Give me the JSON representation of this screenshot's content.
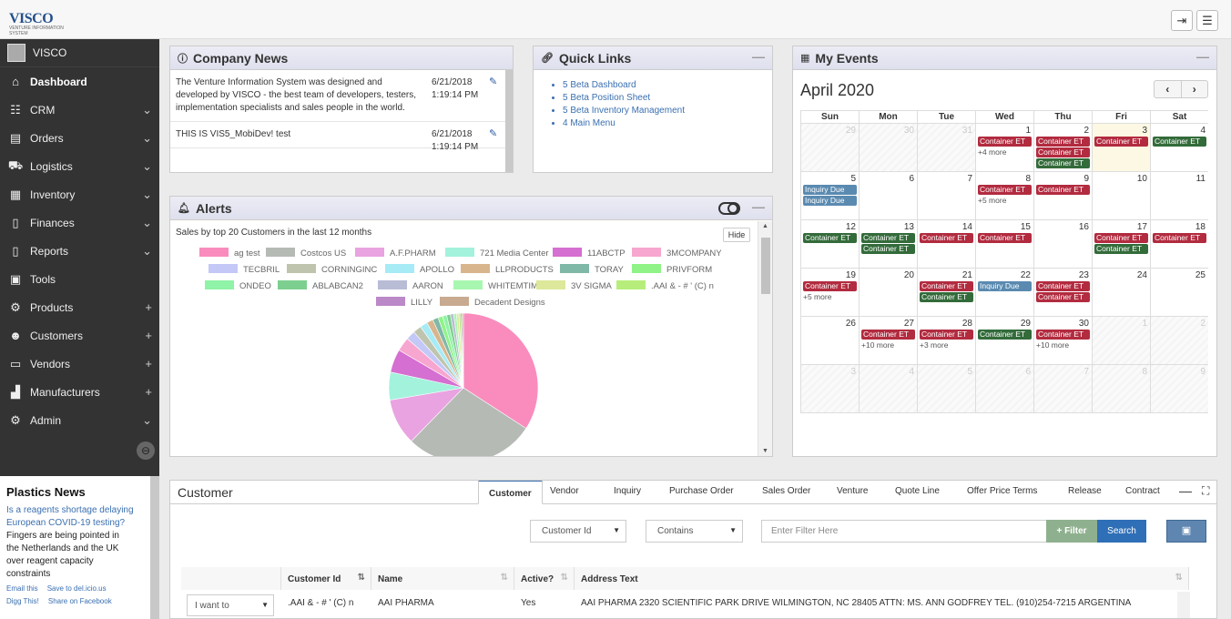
{
  "app": {
    "logo_text": "VISCO",
    "logo_sub": "VENTURE INFORMATION SYSTEM"
  },
  "topbar": {
    "logout_icon": "logout-icon",
    "menu_icon": "hamburger-icon"
  },
  "sidebar": {
    "user": "VISCO",
    "items": [
      {
        "label": "Dashboard",
        "icon": "home-icon",
        "glyph": "⌂",
        "ex": ""
      },
      {
        "label": "CRM",
        "icon": "handshake-icon",
        "glyph": "☷",
        "ex": "⌄"
      },
      {
        "label": "Orders",
        "icon": "orders-icon",
        "glyph": "▤",
        "ex": "⌄"
      },
      {
        "label": "Logistics",
        "icon": "truck-icon",
        "glyph": "⛟",
        "ex": "⌄"
      },
      {
        "label": "Inventory",
        "icon": "warehouse-icon",
        "glyph": "▦",
        "ex": "⌄"
      },
      {
        "label": "Finances",
        "icon": "document-icon",
        "glyph": "▯",
        "ex": "⌄"
      },
      {
        "label": "Reports",
        "icon": "report-icon",
        "glyph": "▯",
        "ex": "⌄"
      },
      {
        "label": "Tools",
        "icon": "briefcase-icon",
        "glyph": "▣",
        "ex": ""
      },
      {
        "label": "Products",
        "icon": "gear-icon",
        "glyph": "⚙",
        "ex": "+"
      },
      {
        "label": "Customers",
        "icon": "users-icon",
        "glyph": "☻",
        "ex": "+"
      },
      {
        "label": "Vendors",
        "icon": "vendor-icon",
        "glyph": "▭",
        "ex": "+"
      },
      {
        "label": "Manufacturers",
        "icon": "factory-icon",
        "glyph": "▟",
        "ex": "+"
      },
      {
        "label": "Admin",
        "icon": "cog-icon",
        "glyph": "⚙",
        "ex": "⌄"
      }
    ]
  },
  "plastics": {
    "title": "Plastics News",
    "headline": "Is a reagents shortage delaying European COVID-19 testing?",
    "body": "Fingers are being pointed in the Netherlands and the UK over reagent capacity constraints",
    "share": [
      "Email this",
      "Save to del.icio.us",
      "Digg This!",
      "Share on Facebook"
    ]
  },
  "company_news": {
    "title": "Company News",
    "rows": [
      {
        "text": "The Venture Information System was designed and developed by VISCO - the best team of developers, testers, implementation specialists and sales people in the world.",
        "date": "6/21/2018 1:19:14 PM"
      },
      {
        "text": "THIS IS VIS5_MobiDev! test",
        "date": "6/21/2018 1:19:14 PM"
      }
    ]
  },
  "quick_links": {
    "title": "Quick Links",
    "links": [
      "5 Beta Dashboard",
      "5 Beta Position Sheet",
      "5 Beta Inventory Management",
      "4 Main Menu"
    ]
  },
  "alerts": {
    "title": "Alerts",
    "subtitle": "Sales by top 20 Customers in the last 12 months",
    "hide": "Hide"
  },
  "chart_data": {
    "type": "pie",
    "title": "Sales by top 20 Customers in the last 12 months",
    "categories": [
      "ag test",
      "Costcos US",
      "A.F.PHARM",
      "721 Media Center",
      "11ABCTP",
      "3MCOMPANY",
      "TECBRIL",
      "CORNINGINC",
      "APOLLO",
      "LLPRODUCTS",
      "TORAY",
      "PRIVFORM",
      "ONDEO",
      "ABLABCAN2",
      "AARON",
      "WHITEMTIM",
      "3V SIGMA",
      ".AAI & - # ' (C) n",
      "LILLY",
      "Decadent Designs"
    ],
    "values": [
      34,
      28,
      10,
      6,
      5,
      3,
      2,
      1.8,
      1.6,
      1.4,
      1.2,
      1,
      0.9,
      0.8,
      0.7,
      0.6,
      0.5,
      0.4,
      0.3,
      0.3
    ],
    "colors": [
      "#f98cbd",
      "#b5bab5",
      "#e9a3e0",
      "#a3f2dc",
      "#d56fd1",
      "#f7a6d0",
      "#c3c8f7",
      "#bfc4ae",
      "#a6ebf5",
      "#d8b58d",
      "#80b8a8",
      "#8ff388",
      "#8ff3a8",
      "#7dcf8f",
      "#b9bcd5",
      "#a8f7b0",
      "#dde89a",
      "#b7ee7b",
      "#bb88c8",
      "#c8aa90"
    ],
    "legend": "top"
  },
  "events": {
    "title": "My Events",
    "month": "April 2020",
    "prev": "‹",
    "next": "›",
    "days": [
      "Sun",
      "Mon",
      "Tue",
      "Wed",
      "Thu",
      "Fri",
      "Sat"
    ],
    "weeks": [
      [
        {
          "d": "29",
          "o": 1
        },
        {
          "d": "30",
          "o": 1
        },
        {
          "d": "31",
          "o": 1
        },
        {
          "d": "1",
          "ev": [
            [
              "Container ET",
              "r"
            ]
          ],
          "more": "+4 more"
        },
        {
          "d": "2",
          "ev": [
            [
              "Container ET",
              "r"
            ],
            [
              "Container ET",
              "r"
            ],
            [
              "Container ET",
              "g"
            ]
          ]
        },
        {
          "d": "3",
          "t": 1,
          "ev": [
            [
              "Container ET",
              "r"
            ]
          ]
        },
        {
          "d": "4",
          "ev": [
            [
              "Container ET",
              "g"
            ]
          ]
        }
      ],
      [
        {
          "d": "5",
          "ev": [
            [
              "Inquiry Due",
              "b"
            ],
            [
              "Inquiry Due",
              "b"
            ]
          ]
        },
        {
          "d": "6"
        },
        {
          "d": "7"
        },
        {
          "d": "8",
          "ev": [
            [
              "Container ET",
              "r"
            ]
          ],
          "more": "+5 more"
        },
        {
          "d": "9",
          "ev": [
            [
              "Container ET",
              "r"
            ]
          ]
        },
        {
          "d": "10"
        },
        {
          "d": "11"
        }
      ],
      [
        {
          "d": "12",
          "ev": [
            [
              "Container ET",
              "g"
            ]
          ]
        },
        {
          "d": "13",
          "ev": [
            [
              "Container ET",
              "g"
            ],
            [
              "Container ET",
              "g"
            ]
          ]
        },
        {
          "d": "14",
          "ev": [
            [
              "Container ET",
              "r"
            ]
          ]
        },
        {
          "d": "15",
          "ev": [
            [
              "Container ET",
              "r"
            ]
          ]
        },
        {
          "d": "16"
        },
        {
          "d": "17",
          "ev": [
            [
              "Container ET",
              "r"
            ],
            [
              "Container ET",
              "g"
            ]
          ]
        },
        {
          "d": "18",
          "ev": [
            [
              "Container ET",
              "r"
            ]
          ]
        }
      ],
      [
        {
          "d": "19",
          "ev": [
            [
              "Container ET",
              "r"
            ]
          ],
          "more": "+5 more"
        },
        {
          "d": "20"
        },
        {
          "d": "21",
          "ev": [
            [
              "Container ET",
              "r"
            ],
            [
              "Container ET",
              "g"
            ]
          ]
        },
        {
          "d": "22",
          "ev": [
            [
              "Inquiry Due",
              "b"
            ]
          ]
        },
        {
          "d": "23",
          "ev": [
            [
              "Container ET",
              "r"
            ],
            [
              "Container ET",
              "r"
            ]
          ]
        },
        {
          "d": "24"
        },
        {
          "d": "25"
        }
      ],
      [
        {
          "d": "26"
        },
        {
          "d": "27",
          "ev": [
            [
              "Container ET",
              "r"
            ]
          ],
          "more": "+10 more"
        },
        {
          "d": "28",
          "ev": [
            [
              "Container ET",
              "r"
            ]
          ],
          "more": "+3 more"
        },
        {
          "d": "29",
          "ev": [
            [
              "Container ET",
              "g"
            ]
          ]
        },
        {
          "d": "30",
          "ev": [
            [
              "Container ET",
              "r"
            ]
          ],
          "more": "+10 more"
        },
        {
          "d": "1",
          "o": 1
        },
        {
          "d": "2",
          "o": 1
        }
      ],
      [
        {
          "d": "3",
          "o": 1
        },
        {
          "d": "4",
          "o": 1
        },
        {
          "d": "5",
          "o": 1
        },
        {
          "d": "6",
          "o": 1
        },
        {
          "d": "7",
          "o": 1
        },
        {
          "d": "8",
          "o": 1
        },
        {
          "d": "9",
          "o": 1
        }
      ]
    ]
  },
  "customer": {
    "title": "Customer",
    "tabs": [
      "Customer",
      "Vendor",
      "Inquiry",
      "Purchase Order",
      "Sales Order",
      "Venture",
      "Quote Line",
      "Offer Price Terms",
      "Release",
      "Contract"
    ],
    "field_select": "Customer Id",
    "op_select": "Contains",
    "filter_placeholder": "Enter Filter Here",
    "filter_btn": "+ Filter",
    "search_btn": "Search",
    "columns": [
      "Customer Id",
      "Name",
      "Active?",
      "Address Text"
    ],
    "row": {
      "action": "I want to",
      "id": ".AAI & - # ' (C) n",
      "name": "AAI PHARMA",
      "active": "Yes",
      "address": "AAI PHARMA 2320 SCIENTIFIC PARK DRIVE WILMINGTON, NC 28405 ATTN: MS. ANN GODFREY TEL. (910)254-7215 ARGENTINA"
    }
  }
}
